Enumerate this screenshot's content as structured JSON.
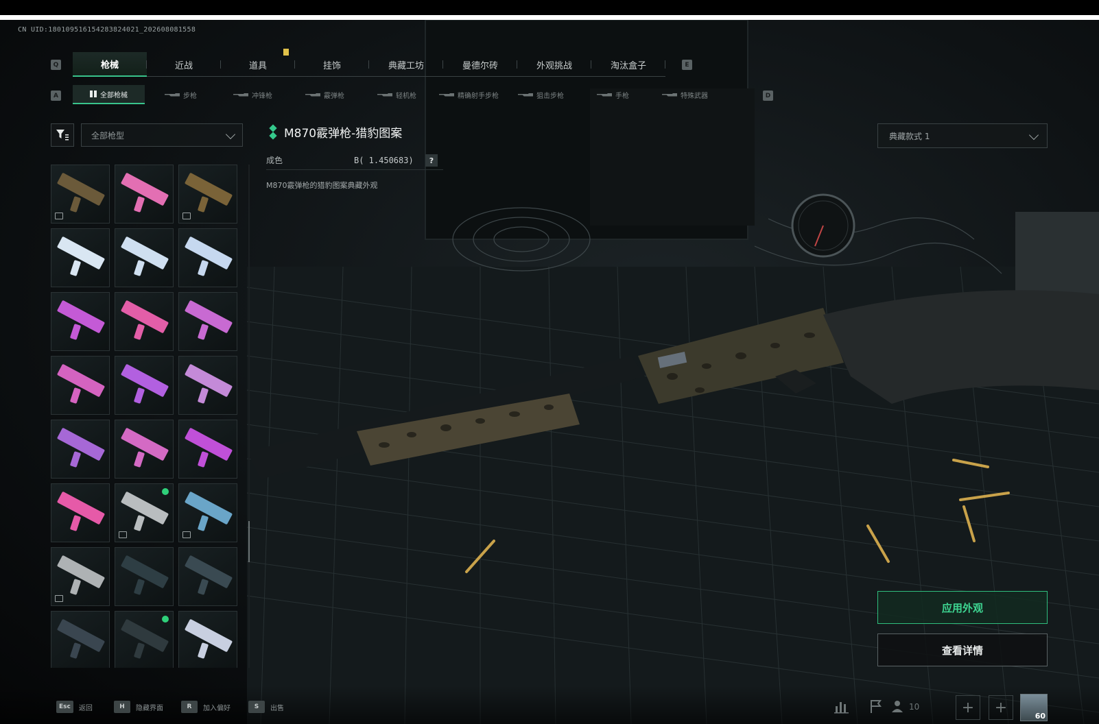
{
  "uid_text": "CN UID:1801095161542838240​21_202608081558",
  "main_tabs": [
    {
      "label": "枪械",
      "active": true
    },
    {
      "label": "近战",
      "active": false
    },
    {
      "label": "道具",
      "active": false
    },
    {
      "label": "挂饰",
      "active": false
    },
    {
      "label": "典藏工坊",
      "active": false
    },
    {
      "label": "曼德尔砖",
      "active": false
    },
    {
      "label": "外观挑战",
      "active": false
    },
    {
      "label": "淘汰盒子",
      "active": false
    }
  ],
  "main_tabs_keys": {
    "prev": "Q",
    "next": "E"
  },
  "sub_tabs": [
    {
      "label": "全部枪械",
      "active": true
    },
    {
      "label": "步枪",
      "active": false
    },
    {
      "label": "冲锋枪",
      "active": false
    },
    {
      "label": "霰弹枪",
      "active": false
    },
    {
      "label": "轻机枪",
      "active": false
    },
    {
      "label": "精确射手步枪",
      "active": false
    },
    {
      "label": "狙击步枪",
      "active": false
    },
    {
      "label": "手枪",
      "active": false
    },
    {
      "label": "特殊武器",
      "active": false
    }
  ],
  "sub_tabs_keys": {
    "prev": "A",
    "next": "D"
  },
  "filter": {
    "dropdown_value": "全部枪型"
  },
  "item": {
    "title": "M870霰弹枪-猎豹图案",
    "quality_label": "成色",
    "quality_value": "B( 1.450683)",
    "help": "?",
    "description": "M870霰弹枪的猎豹图案典藏外观"
  },
  "style_dropdown": "典藏款式 1",
  "buttons": {
    "apply": "应用外观",
    "details": "查看详情"
  },
  "bottom_hints": [
    {
      "key": "Esc",
      "label": "返回"
    },
    {
      "key": "H",
      "label": "隐藏界面"
    },
    {
      "key": "R",
      "label": "加入偏好"
    },
    {
      "key": "S",
      "label": "出售"
    }
  ],
  "friends_count": "10",
  "player_level": "60",
  "accent_color": "#39c48c",
  "grid_items": [
    {
      "color": "#6b5a3a",
      "icon": true,
      "dot": false
    },
    {
      "color": "#e36fb3",
      "icon": false,
      "dot": false
    },
    {
      "color": "#7a6338",
      "icon": true,
      "dot": false
    },
    {
      "color": "#d9e6f2",
      "icon": false,
      "dot": false
    },
    {
      "color": "#cfdff0",
      "icon": false,
      "dot": false
    },
    {
      "color": "#c6d8ef",
      "icon": false,
      "dot": false
    },
    {
      "color": "#c45ad6",
      "icon": false,
      "dot": false
    },
    {
      "color": "#e35ea8",
      "icon": false,
      "dot": false
    },
    {
      "color": "#c86ad2",
      "icon": false,
      "dot": false
    },
    {
      "color": "#d463c0",
      "icon": false,
      "dot": false
    },
    {
      "color": "#b260e0",
      "icon": false,
      "dot": false
    },
    {
      "color": "#c48ad8",
      "icon": false,
      "dot": false
    },
    {
      "color": "#a668d6",
      "icon": false,
      "dot": false
    },
    {
      "color": "#d46ac4",
      "icon": false,
      "dot": false
    },
    {
      "color": "#c050d8",
      "icon": false,
      "dot": false
    },
    {
      "color": "#e65aa8",
      "icon": false,
      "dot": false
    },
    {
      "color": "#b9bdbf",
      "icon": true,
      "dot": true
    },
    {
      "color": "#6aa5c8",
      "icon": true,
      "dot": false
    },
    {
      "color": "#aeb2b4",
      "icon": true,
      "dot": false
    },
    {
      "color": "#2e3e44",
      "icon": false,
      "dot": false
    },
    {
      "color": "#3a4a52",
      "icon": false,
      "dot": false
    },
    {
      "color": "#3a4650",
      "icon": false,
      "dot": false
    },
    {
      "color": "#2f3a3e",
      "icon": false,
      "dot": true
    },
    {
      "color": "#c8cfe0",
      "icon": false,
      "dot": false
    }
  ]
}
